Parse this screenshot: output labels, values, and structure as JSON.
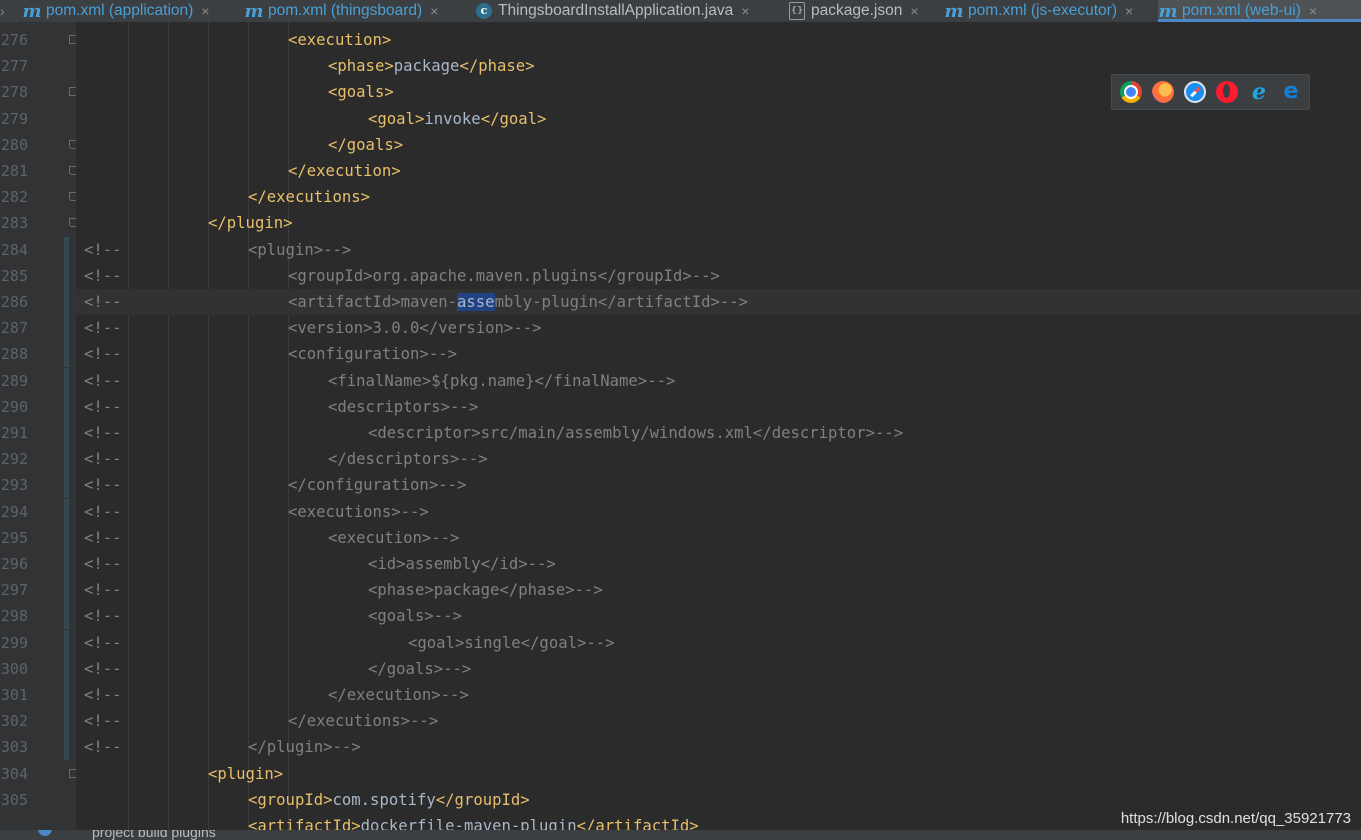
{
  "tabs": [
    {
      "icon": "maven-pom-icon",
      "label": "pom.xml (application)",
      "active": false
    },
    {
      "icon": "maven-pom-icon",
      "label": "pom.xml (thingsboard)",
      "active": false
    },
    {
      "icon": "java-class-icon",
      "label": "ThingsboardInstallApplication.java",
      "active": false
    },
    {
      "icon": "json-file-icon",
      "label": "package.json",
      "active": false
    },
    {
      "icon": "maven-pom-icon",
      "label": "pom.xml (js-executor)",
      "active": false
    },
    {
      "icon": "maven-pom-icon",
      "label": "pom.xml (web-ui)",
      "active": true
    }
  ],
  "tab_close_glyph": "×",
  "tab_icon_glyphs": {
    "maven": "m",
    "java": "c",
    "json": "{}"
  },
  "editor": {
    "current_line": 286,
    "lines": [
      {
        "n": "276",
        "t": [
          [
            "t",
            "<execution>"
          ]
        ]
      },
      {
        "n": "277",
        "t": [
          [
            "t",
            "<phase>"
          ],
          [
            "tx",
            "package"
          ],
          [
            "t",
            "</phase>"
          ]
        ]
      },
      {
        "n": "278",
        "t": [
          [
            "t",
            "<goals>"
          ]
        ]
      },
      {
        "n": "279",
        "t": [
          [
            "t",
            "<goal>"
          ],
          [
            "tx",
            "invoke"
          ],
          [
            "t",
            "</goal>"
          ]
        ]
      },
      {
        "n": "280",
        "t": [
          [
            "t",
            "</goals>"
          ]
        ]
      },
      {
        "n": "281",
        "t": [
          [
            "t",
            "</execution>"
          ]
        ]
      },
      {
        "n": "282",
        "t": [
          [
            "t",
            "</executions>"
          ]
        ]
      },
      {
        "n": "283",
        "t": [
          [
            "t",
            "</plugin>"
          ]
        ]
      },
      {
        "n": "284",
        "t": [
          [
            "c",
            "<plugin>-->"
          ]
        ]
      },
      {
        "n": "285",
        "t": [
          [
            "c",
            "<groupId>org.apache.maven.plugins</groupId>-->"
          ]
        ]
      },
      {
        "n": "286",
        "t": [
          [
            "c",
            "<artifactId>maven-"
          ],
          [
            "sel",
            "asse"
          ],
          [
            "c",
            "mbly-plugin</artifactId>-->"
          ]
        ]
      },
      {
        "n": "287",
        "t": [
          [
            "c",
            "<version>3.0.0</version>-->"
          ]
        ]
      },
      {
        "n": "288",
        "t": [
          [
            "c",
            "<configuration>-->"
          ]
        ]
      },
      {
        "n": "289",
        "t": [
          [
            "c",
            "<finalName>${pkg.name}</finalName>-->"
          ]
        ]
      },
      {
        "n": "290",
        "t": [
          [
            "c",
            "<descriptors>-->"
          ]
        ]
      },
      {
        "n": "291",
        "t": [
          [
            "c",
            "<descriptor>src/main/assembly/windows.xml</descriptor>-->"
          ]
        ]
      },
      {
        "n": "292",
        "t": [
          [
            "c",
            "</descriptors>-->"
          ]
        ]
      },
      {
        "n": "293",
        "t": [
          [
            "c",
            "</configuration>-->"
          ]
        ]
      },
      {
        "n": "294",
        "t": [
          [
            "c",
            "<executions>-->"
          ]
        ]
      },
      {
        "n": "295",
        "t": [
          [
            "c",
            "<execution>-->"
          ]
        ]
      },
      {
        "n": "296",
        "t": [
          [
            "c",
            "<id>assembly</id>-->"
          ]
        ]
      },
      {
        "n": "297",
        "t": [
          [
            "c",
            "<phase>package</phase>-->"
          ]
        ]
      },
      {
        "n": "298",
        "t": [
          [
            "c",
            "<goals>-->"
          ]
        ]
      },
      {
        "n": "299",
        "t": [
          [
            "c",
            "<goal>single</goal>-->"
          ]
        ]
      },
      {
        "n": "300",
        "t": [
          [
            "c",
            "</goals>-->"
          ]
        ]
      },
      {
        "n": "301",
        "t": [
          [
            "c",
            "</execution>-->"
          ]
        ]
      },
      {
        "n": "302",
        "t": [
          [
            "c",
            "</executions>-->"
          ]
        ]
      },
      {
        "n": "303",
        "t": [
          [
            "c",
            "</plugin>-->"
          ]
        ]
      },
      {
        "n": "304",
        "t": [
          [
            "t",
            "<plugin>"
          ]
        ]
      },
      {
        "n": "305",
        "t": [
          [
            "t",
            "<groupId>"
          ],
          [
            "tx",
            "com.spotify"
          ],
          [
            "t",
            "</groupId>"
          ]
        ]
      },
      {
        "n": "",
        "t": [
          [
            "t",
            "<artifactId>"
          ],
          [
            "tx",
            "dockerfile-maven-plugin"
          ],
          [
            "t",
            "</artifactId>"
          ]
        ]
      }
    ],
    "comment_prefix": "<!--"
  },
  "browser_bar": {
    "icons": [
      "chrome-icon",
      "firefox-icon",
      "safari-icon",
      "opera-icon",
      "internet-explorer-icon",
      "edge-icon"
    ],
    "ie_glyph": "e",
    "edge_glyph": "e"
  },
  "breadcrumb": "project  build  plugins",
  "watermark": "https://blog.csdn.net/qq_35921773",
  "colors": {
    "background": "#2b2b2b",
    "gutter": "#313335",
    "tag": "#e8bf6a",
    "text": "#a9b7c6",
    "comment": "#808080",
    "selection": "#214283",
    "line_number": "#606366",
    "tab_active_underline": "#4a88c7"
  }
}
